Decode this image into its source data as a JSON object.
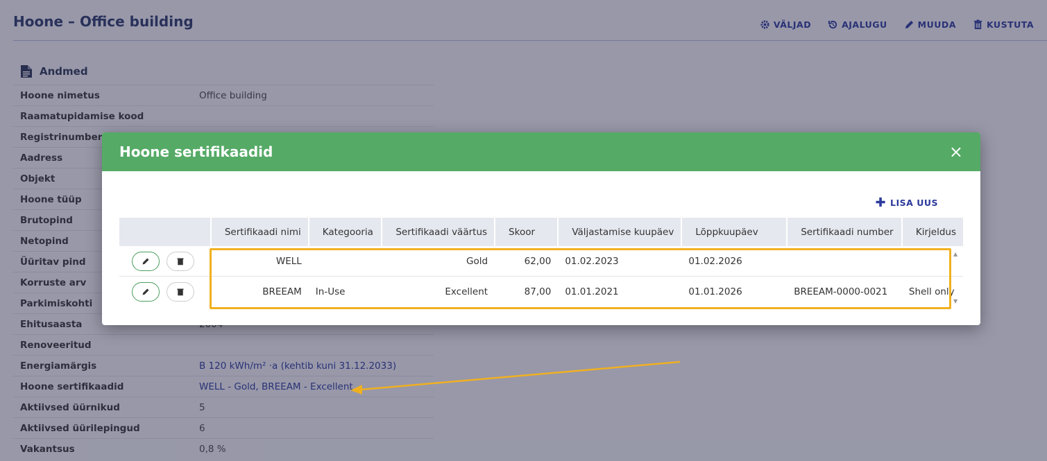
{
  "page": {
    "title": "Hoone – Office building"
  },
  "toolbar": {
    "fields": "VÄLJAD",
    "history": "AJALUGU",
    "edit": "MUUDA",
    "delete": "KUSTUTA"
  },
  "section": {
    "title": "Andmed"
  },
  "info": [
    {
      "label": "Hoone nimetus",
      "value": "Office building"
    },
    {
      "label": "Raamatupidamise kood",
      "value": ""
    },
    {
      "label": "Registrinumber",
      "value": ""
    },
    {
      "label": "Aadress",
      "value": ""
    },
    {
      "label": "Objekt",
      "value": ""
    },
    {
      "label": "Hoone tüüp",
      "value": ""
    },
    {
      "label": "Brutopind",
      "value": ""
    },
    {
      "label": "Netopind",
      "value": ""
    },
    {
      "label": "Üüritav pind",
      "value": ""
    },
    {
      "label": "Korruste arv",
      "value": ""
    },
    {
      "label": "Parkimiskohti",
      "value": ""
    },
    {
      "label": "Ehitusaasta",
      "value": "2004"
    },
    {
      "label": "Renoveeritud",
      "value": ""
    },
    {
      "label": "Energiamärgis",
      "value": "B 120 kWh/m² ·a (kehtib kuni 31.12.2033)"
    },
    {
      "label": "Hoone sertifikaadid",
      "value": "WELL - Gold, BREEAM - Excellent"
    },
    {
      "label": "Aktiivsed üürnikud",
      "value": "5"
    },
    {
      "label": "Aktiivsed üürilepingud",
      "value": "6"
    },
    {
      "label": "Vakantsus",
      "value": "0,8 %"
    }
  ],
  "modal": {
    "title": "Hoone sertifikaadid",
    "close": "×",
    "add_new": "LISA UUS",
    "columns": [
      "Sertifikaadi nimi",
      "Kategooria",
      "Sertifikaadi väärtus",
      "Skoor",
      "Väljastamise kuupäev",
      "Lõppkuupäev",
      "Sertifikaadi number",
      "Kirjeldus"
    ],
    "rows": [
      {
        "name": "WELL",
        "category": "",
        "value": "Gold",
        "score": "62,00",
        "issued": "01.02.2023",
        "expires": "01.02.2026",
        "number": "",
        "description": ""
      },
      {
        "name": "BREEAM",
        "category": "In-Use",
        "value": "Excellent",
        "score": "87,00",
        "issued": "01.01.2021",
        "expires": "01.01.2026",
        "number": "BREEAM-0000-0021",
        "description": "Shell only"
      }
    ]
  },
  "colors": {
    "accent": "#55aa66",
    "link": "#2b3a9b",
    "highlight": "#f0b020"
  },
  "icons": [
    "gear-icon",
    "history-icon",
    "pencil-icon",
    "trash-icon",
    "document-icon",
    "close-icon",
    "plus-icon"
  ]
}
